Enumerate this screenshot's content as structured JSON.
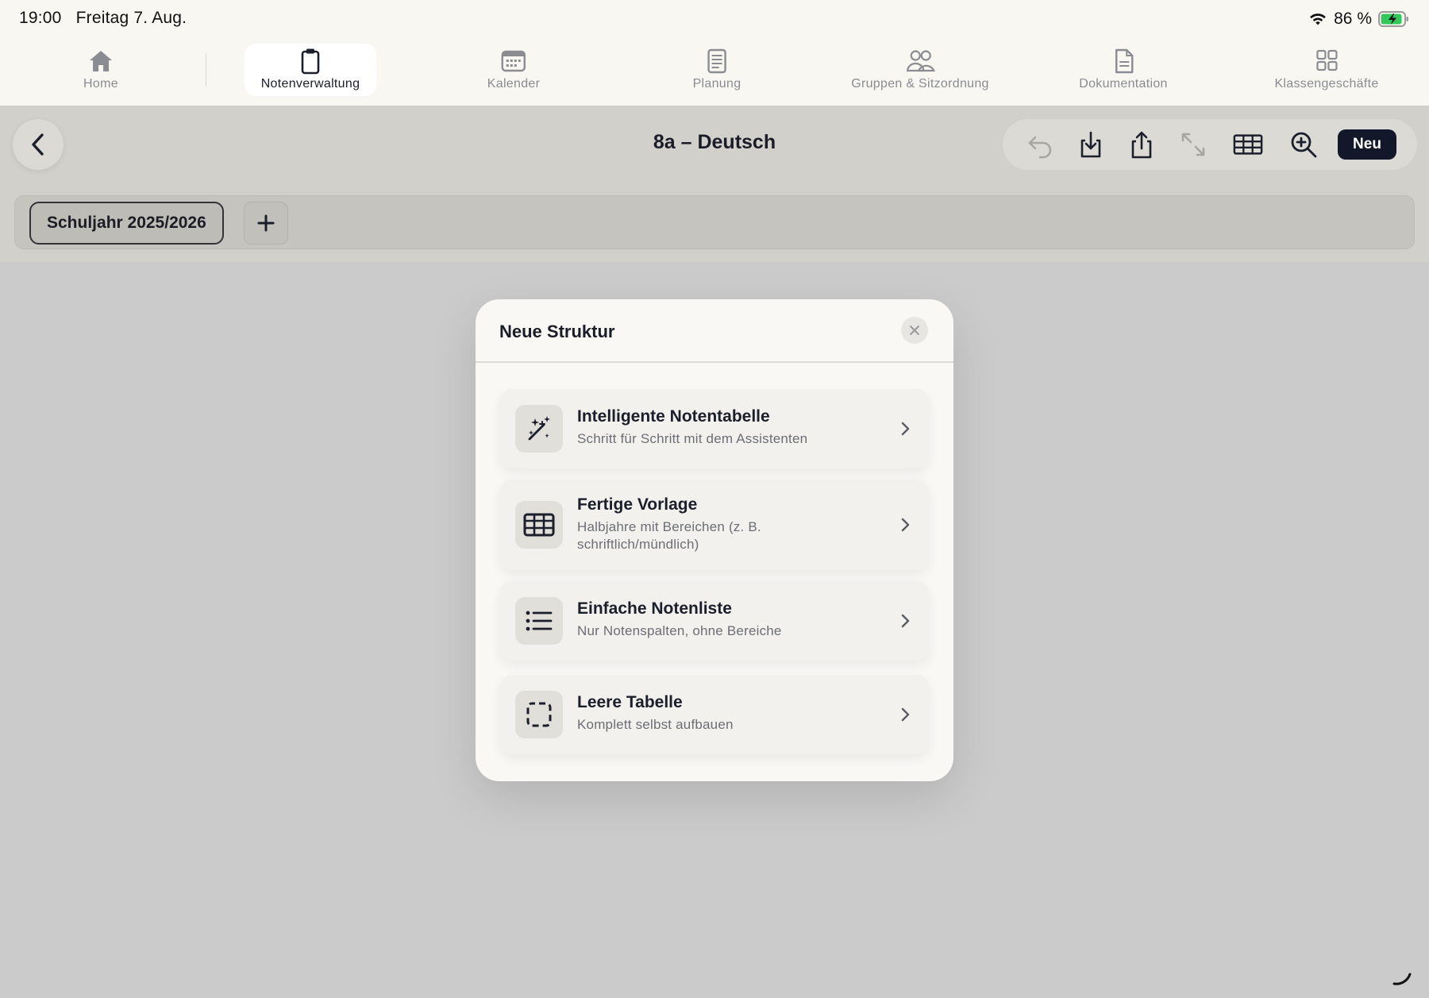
{
  "status": {
    "time": "19:00",
    "date": "Freitag 7. Aug.",
    "battery": "86 %"
  },
  "tabs": [
    {
      "label": "Home",
      "icon": "home-icon"
    },
    {
      "label": "Notenverwaltung",
      "icon": "clipboard-icon",
      "active": true
    },
    {
      "label": "Kalender",
      "icon": "calendar-icon"
    },
    {
      "label": "Planung",
      "icon": "document-list-icon"
    },
    {
      "label": "Gruppen & Sitzordnung",
      "icon": "people-icon"
    },
    {
      "label": "Dokumentation",
      "icon": "document-icon"
    },
    {
      "label": "Klassengeschäfte",
      "icon": "grid-icon"
    }
  ],
  "toolbar": {
    "title": "8a – Deutsch",
    "new_label": "Neu"
  },
  "year_bar": {
    "active_year": "Schuljahr 2025/2026"
  },
  "modal": {
    "title": "Neue Struktur",
    "options": [
      {
        "title": "Intelligente Notentabelle",
        "subtitle": "Schritt für Schritt mit dem Assistenten",
        "icon": "magic-wand-icon"
      },
      {
        "title": "Fertige Vorlage",
        "subtitle": "Halbjahre mit Bereichen (z. B. schriftlich/mündlich)",
        "icon": "table-icon"
      },
      {
        "title": "Einfache Notenliste",
        "subtitle": "Nur Notenspalten, ohne Bereiche",
        "icon": "list-icon"
      },
      {
        "title": "Leere Tabelle",
        "subtitle": "Komplett selbst aufbauen",
        "icon": "dashed-square-icon"
      }
    ]
  },
  "colors": {
    "accent_dark": "#121829",
    "battery_green": "#34c759"
  }
}
